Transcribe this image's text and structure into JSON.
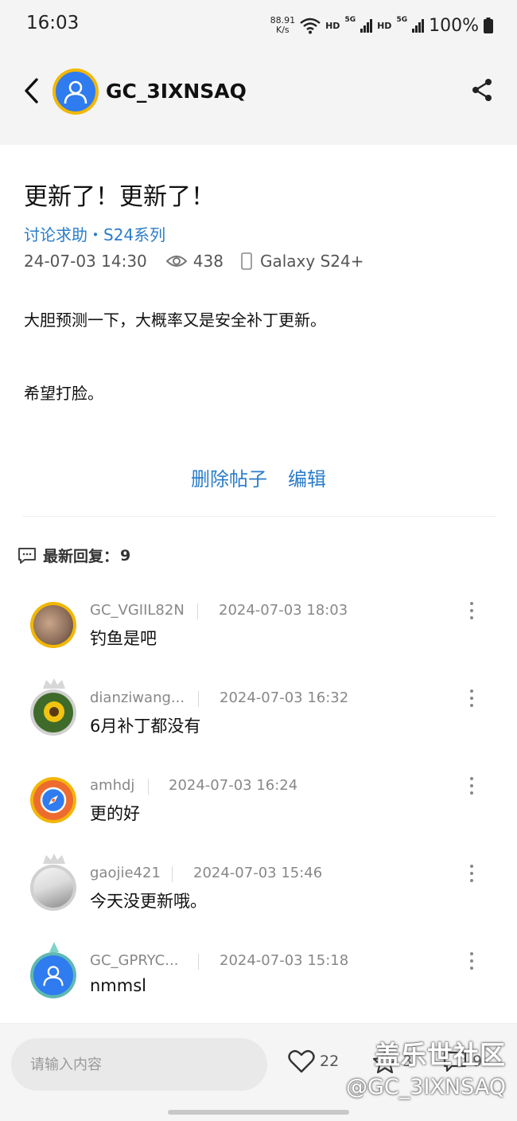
{
  "status_bar": {
    "time": "16:03",
    "net_speed_value": "88.91",
    "net_speed_unit": "K/s",
    "hd1": "HD",
    "net1": "5G",
    "hd2": "HD",
    "net2": "5G",
    "battery": "100%"
  },
  "header": {
    "username": "GC_3IXNSAQ",
    "avatar_ring_color": "#f2b705",
    "avatar_color": "#2f7bf0"
  },
  "post": {
    "title": "更新了！更新了！",
    "category": "讨论求助・S24系列",
    "date": "24-07-03 14:30",
    "views": "438",
    "device": "Galaxy S24+",
    "body_line1": "大胆预测一下，大概率又是安全补丁更新。",
    "body_line2": "希望打脸。",
    "delete_label": "删除帖子",
    "edit_label": "编辑"
  },
  "replies_header": {
    "label": "最新回复：",
    "count": "9"
  },
  "replies": [
    {
      "name": "GC_VGIIL82N",
      "time": "2024-07-03 18:03",
      "text": "钓鱼是吧"
    },
    {
      "name": "dianziwang...",
      "time": "2024-07-03 16:32",
      "text": "6月补丁都没有"
    },
    {
      "name": "amhdj",
      "time": "2024-07-03 16:24",
      "text": "更的好"
    },
    {
      "name": "gaojie421",
      "time": "2024-07-03 15:46",
      "text": "今天没更新哦。"
    },
    {
      "name": "GC_GPRYC...",
      "time": "2024-07-03 15:18",
      "text": "nmmsl"
    }
  ],
  "bottom_bar": {
    "input_placeholder": "请输入内容",
    "likes": "22",
    "favorites": "3",
    "comments": "9"
  },
  "watermark": {
    "line1": "盖乐世社区",
    "line2": "@GC_3IXNSAQ"
  },
  "colors": {
    "link_blue": "#2b7cc9",
    "header_bg": "#f4f4f4"
  }
}
